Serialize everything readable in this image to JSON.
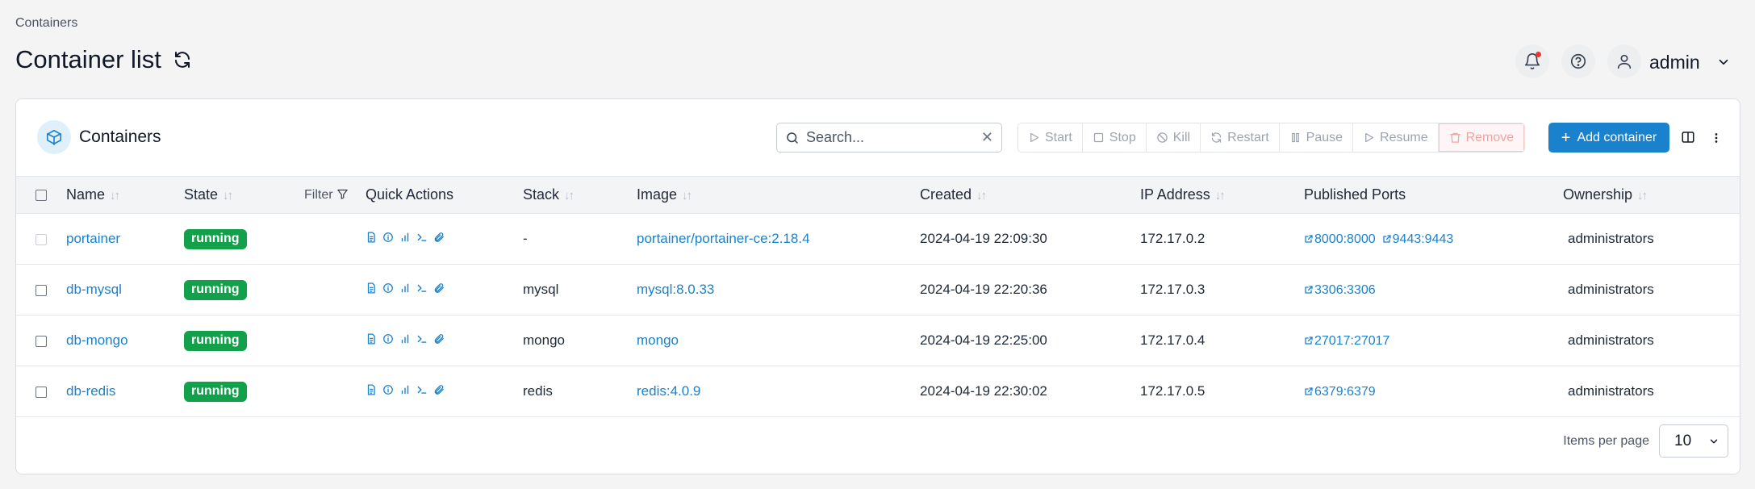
{
  "breadcrumb": "Containers",
  "page_title": "Container list",
  "user": {
    "name": "admin"
  },
  "card": {
    "title": "Containers"
  },
  "search": {
    "placeholder": "Search..."
  },
  "actions": {
    "start": "Start",
    "stop": "Stop",
    "kill": "Kill",
    "restart": "Restart",
    "pause": "Pause",
    "resume": "Resume",
    "remove": "Remove",
    "add": "Add container"
  },
  "columns": {
    "name": "Name",
    "state": "State",
    "filter": "Filter",
    "quick_actions": "Quick Actions",
    "stack": "Stack",
    "image": "Image",
    "created": "Created",
    "ip": "IP Address",
    "ports": "Published Ports",
    "ownership": "Ownership"
  },
  "rows": [
    {
      "name": "portainer",
      "state": "running",
      "stack": "-",
      "image": "portainer/portainer-ce:2.18.4",
      "created": "2024-04-19 22:09:30",
      "ip": "172.17.0.2",
      "ports": [
        "8000:8000",
        "9443:9443"
      ],
      "ownership": "administrators"
    },
    {
      "name": "db-mysql",
      "state": "running",
      "stack": "mysql",
      "image": "mysql:8.0.33",
      "created": "2024-04-19 22:20:36",
      "ip": "172.17.0.3",
      "ports": [
        "3306:3306"
      ],
      "ownership": "administrators"
    },
    {
      "name": "db-mongo",
      "state": "running",
      "stack": "mongo",
      "image": "mongo",
      "created": "2024-04-19 22:25:00",
      "ip": "172.17.0.4",
      "ports": [
        "27017:27017"
      ],
      "ownership": "administrators"
    },
    {
      "name": "db-redis",
      "state": "running",
      "stack": "redis",
      "image": "redis:4.0.9",
      "created": "2024-04-19 22:30:02",
      "ip": "172.17.0.5",
      "ports": [
        "6379:6379"
      ],
      "ownership": "administrators"
    }
  ],
  "pagination": {
    "label": "Items per page",
    "value": "10"
  },
  "colors": {
    "accent": "#1a82cc",
    "running": "#12a04b",
    "remove": "#f0a3a3"
  }
}
